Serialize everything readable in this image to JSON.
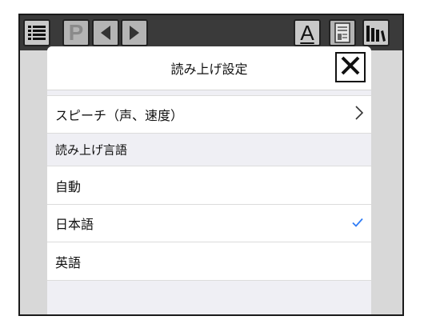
{
  "toolbar": {
    "buttons": [
      {
        "name": "list-menu",
        "icon": "list-icon"
      },
      {
        "name": "page",
        "label": "P"
      },
      {
        "name": "prev",
        "icon": "triangle-left-icon"
      },
      {
        "name": "next",
        "icon": "triangle-right-icon"
      },
      {
        "name": "font",
        "label": "A"
      },
      {
        "name": "document",
        "icon": "document-icon"
      },
      {
        "name": "library",
        "icon": "books-icon"
      }
    ]
  },
  "panel": {
    "title": "読み上げ設定",
    "close_icon": "close-x-icon",
    "speech_row": {
      "label": "スピーチ（声、速度）",
      "icon": "chevron-right-icon"
    },
    "section_header": "読み上げ言語",
    "languages": [
      {
        "label": "自動",
        "selected": false
      },
      {
        "label": "日本語",
        "selected": true
      },
      {
        "label": "英語",
        "selected": false
      }
    ]
  },
  "colors": {
    "accent_check": "#2f7cf6",
    "panel_bg": "#efeff4",
    "toolbar_bg": "#3a3a3a"
  }
}
